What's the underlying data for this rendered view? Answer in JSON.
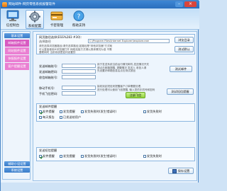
{
  "window": {
    "title": "网站邮件-网页零售系统报警软件",
    "min_label": "–",
    "close_label": "×"
  },
  "toolbar": {
    "items": [
      {
        "label": "信控制台"
      },
      {
        "label": "系统配置"
      },
      {
        "label": "卡密管理"
      },
      {
        "label": "帮助支持"
      }
    ]
  },
  "sidebar": {
    "head_top": "基本设置",
    "items": [
      {
        "label": "邮箱报件设置"
      },
      {
        "label": "网站报件设置"
      },
      {
        "label": "快报报件设置"
      },
      {
        "label": "客户提醒设置"
      }
    ],
    "head_bottom1": "辅助小设设置",
    "head_bottom2": "系统设置"
  },
  "content": {
    "path_label": "网页路径选择(ESS%283 #30):",
    "path_sub": "选择路径",
    "path_value": "C:\\Program Files\\Internet Explorer\\iexplore.exe",
    "path_button": "浏览目录",
    "path_note_line1": "请先选择浏览器路径(请先选择路径)如路径是\"其他浏览器\"方式就",
    "path_note_line2": "可以直接使用IE浏览器打开 网络连接方式请以具体情况为准 不需",
    "path_note_line3": "要联网时 当前系统是如何设置的",
    "default_button": "测试默认",
    "mail_user_label": "发送邮箱账号:",
    "mail_pass_label": "发送邮箱密码:",
    "recv_mail_label": "收信邮箱账号:",
    "mail_note_line1": "用于发送系统当前运行情况邮件,发送情况开关",
    "mail_note_line2": "请点击邮箱提醒, 提醒情况 发送人 收信人请",
    "mail_note_line3": "先设置好邮箱信息后点击测试按钮",
    "mail_test_button": "测试邮件",
    "phone_label": "移动手机号:",
    "fetion_label": "手机飞信密码:",
    "phone_note_line1": "接收到此短信来提醒客户订单需要处理,",
    "phone_note_line2": "进行处理可以使用飞信提醒, 输入您的手机号和密码",
    "fetion_button": "注册飞信",
    "sms_test_button": "测试短信提醒",
    "group1_title": "发送邮件提醒",
    "group1_row1": [
      {
        "label": "发件提醒",
        "checked": true
      },
      {
        "label": "发货提醒",
        "checked": false
      },
      {
        "label": "发货失败时(发生错误时)",
        "checked": false
      },
      {
        "label": "发货失败时",
        "checked": false
      }
    ],
    "group1_row2": [
      {
        "label": "每天报告",
        "checked": false
      },
      {
        "label": "已发送给用户",
        "checked": false
      }
    ],
    "group2_title": "发送短信提醒",
    "group2_row1": [
      {
        "label": "发件提醒",
        "checked": true
      },
      {
        "label": "发货提醒",
        "checked": false
      },
      {
        "label": "发货失败时(发生错误时)",
        "checked": false
      },
      {
        "label": "发货失败时",
        "checked": false
      }
    ],
    "save_button": "保存设置"
  },
  "colors": {
    "accent": "#2a6fbd",
    "sidebar_item": "#ea7fd2",
    "close": "#d9453b"
  }
}
